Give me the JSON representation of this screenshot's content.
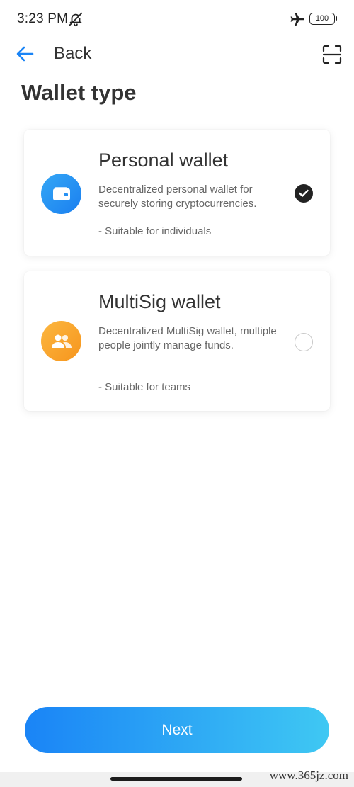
{
  "status_bar": {
    "time": "3:23 PM",
    "mute_icon": "notifications-muted-icon",
    "airplane_icon": "airplane-mode-icon",
    "battery": "100"
  },
  "header": {
    "back_label": "Back",
    "back_icon": "arrow-left-icon",
    "scan_icon": "scan-icon"
  },
  "page": {
    "title": "Wallet type"
  },
  "wallets": [
    {
      "title": "Personal wallet",
      "description": "Decentralized personal wallet for securely storing cryptocurrencies.",
      "note": "- Suitable for individuals",
      "icon": "wallet-icon",
      "icon_color": "#1a7ff0",
      "selected": true
    },
    {
      "title": "MultiSig wallet",
      "description": "Decentralized MultiSig wallet, multiple people jointly manage funds.",
      "note": "- Suitable for teams",
      "icon": "users-icon",
      "icon_color": "#f6951d",
      "selected": false
    }
  ],
  "footer": {
    "next_label": "Next",
    "watermark": "www.365jz.com"
  },
  "colors": {
    "accent": "#1a84f6",
    "accent_end": "#3fc8f3",
    "text": "#333333",
    "muted": "#666666"
  }
}
